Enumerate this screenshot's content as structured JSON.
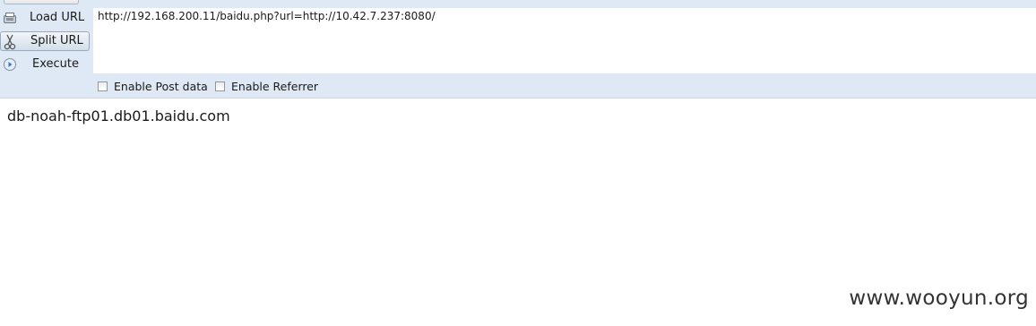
{
  "sidebar": {
    "load_label": "Load URL",
    "split_label": "Split URL",
    "execute_label": "Execute"
  },
  "url_field": {
    "value": "http://192.168.200.11/baidu.php?url=http://10.42.7.237:8080/"
  },
  "options": {
    "post_label": "Enable Post data",
    "referrer_label": "Enable Referrer"
  },
  "content": {
    "body_text": "db-noah-ftp01.db01.baidu.com"
  },
  "watermark": {
    "text": "www.wooyun.org"
  },
  "icons": {
    "load": "load-url-icon",
    "split": "scissors-icon",
    "execute": "play-icon"
  },
  "colors": {
    "toolbar_bg": "#dfe9f5",
    "accent_blue": "#3a78c3"
  }
}
